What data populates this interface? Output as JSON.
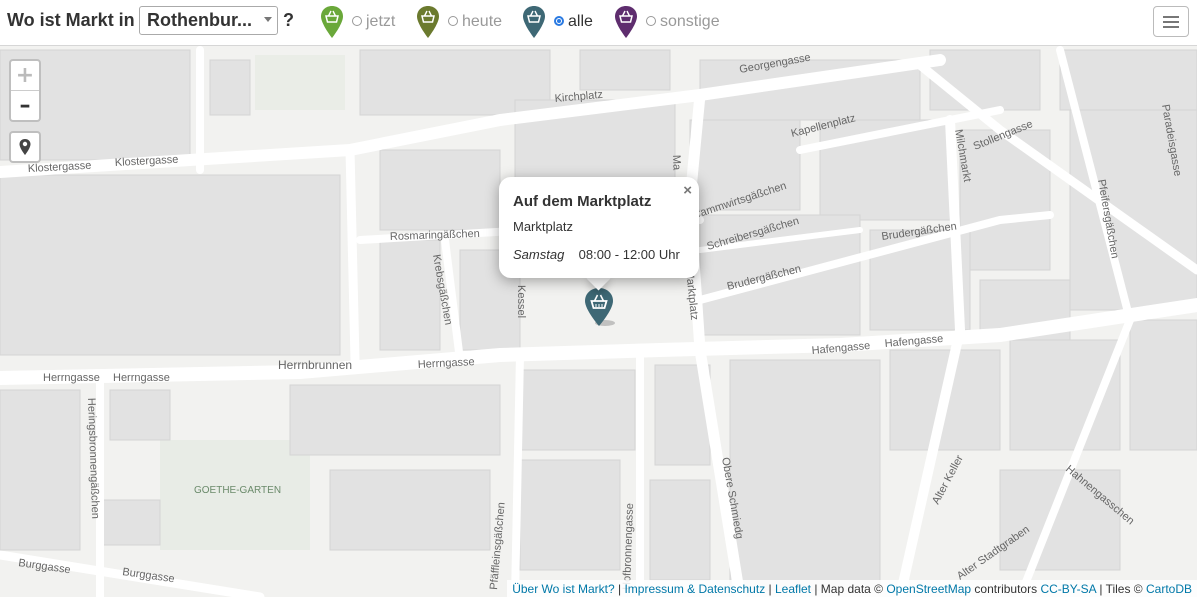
{
  "header": {
    "title": "Wo ist Markt in",
    "city_selected": "Rothenbur...",
    "question_mark": "?"
  },
  "filters": [
    {
      "label": "jetzt",
      "color": "#6aa83a",
      "checked": false
    },
    {
      "label": "heute",
      "color": "#6b7a2e",
      "checked": false
    },
    {
      "label": "alle",
      "color": "#3e6875",
      "checked": true
    },
    {
      "label": "sonstige",
      "color": "#5e2d6e",
      "checked": false
    }
  ],
  "zoom": {
    "in": "+",
    "out": "–"
  },
  "popup": {
    "title": "Auf dem Marktplatz",
    "subtitle": "Marktplatz",
    "day": "Samstag",
    "hours": "08:00 - 12:00 Uhr",
    "close": "×"
  },
  "marker_color": "#3e6875",
  "streets": {
    "georgengasse": "Georgengasse",
    "kirchplatz": "Kirchplatz",
    "klostergasse1": "Klostergasse",
    "klostergasse2": "Klostergasse",
    "kapellenplatz": "Kapellenplatz",
    "milchmarkt": "Milchmarkt",
    "stollengasse": "Stollengasse",
    "paradeisgasse": "Paradeisgasse",
    "pfeifersgasschen": "Pfeifersgäßchen",
    "rosmaringasschen": "Rosmaringäßchen",
    "krebsgasschen": "Krebsgäßchen",
    "kessel": "Kessel",
    "marktplatz_v1": "Ma",
    "marktplatz_v2": "Marktplatz",
    "grammwirtsgasschen": "Grammwirtsgäßchen",
    "schreibersgasschen": "Schreibersgäßchen",
    "brudergasschen1": "Brudergäßchen",
    "brudergasschen2": "Brudergäßchen",
    "hafengasse1": "Hafengasse",
    "hafengasse2": "Hafengasse",
    "herrnbrunnen": "Herrnbrunnen",
    "herrngasse1": "Herrngasse",
    "herrngasse2": "Herrngasse",
    "herrngasse3": "Herrngasse",
    "heringsbronnengasschen": "Heringsbronnengäßchen",
    "goethegarten": "GOETHE-GARTEN",
    "pfaffleinsgasschen": "Pfäffleinsgäßchen",
    "hofbronnengasse": "Hofbronnengasse",
    "obere_schmiedg": "Obere Schmiedg",
    "alter_keller": "Alter Keller",
    "alter_stadtgraben": "Alter Stadtgraben",
    "hahnengasse": "Hahnengasschen",
    "burggasse1": "Burggasse",
    "burggasse2": "Burggasse"
  },
  "attribution": {
    "about": "Über Wo ist Markt?",
    "sep1": " | ",
    "impressum": "Impressum & Datenschutz",
    "sep2": " | ",
    "leaflet": "Leaflet",
    "mapdata": " | Map data © ",
    "osm": "OpenStreetMap",
    "contributors": " contributors ",
    "license": "CC-BY-SA",
    "tiles": " | Tiles © ",
    "carto": "CartoDB"
  }
}
